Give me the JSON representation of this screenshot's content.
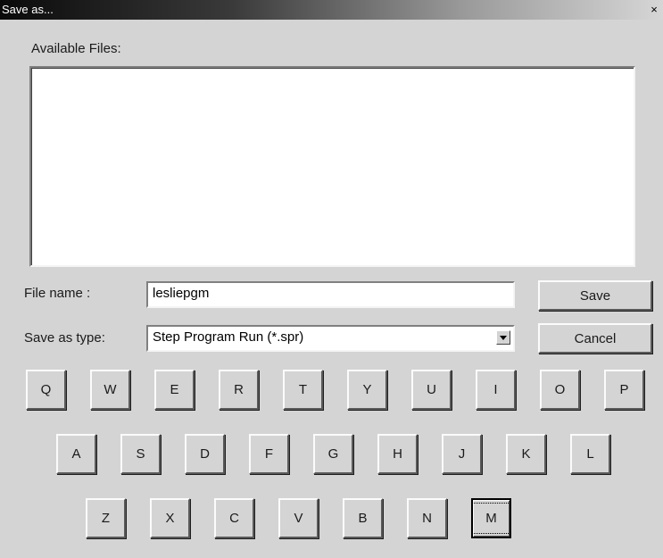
{
  "window": {
    "title": "Save as...",
    "close_glyph": "×"
  },
  "labels": {
    "available_files": "Available Files:",
    "file_name": "File name :",
    "save_as_type": "Save as type:"
  },
  "file_name_value": "lesliepgm",
  "save_type": {
    "selected": "Step Program Run (*.spr)"
  },
  "buttons": {
    "save": "Save",
    "cancel": "Cancel"
  },
  "keyboard": {
    "row1": [
      "Q",
      "W",
      "E",
      "R",
      "T",
      "Y",
      "U",
      "I",
      "O",
      "P"
    ],
    "row2": [
      "A",
      "S",
      "D",
      "F",
      "G",
      "H",
      "J",
      "K",
      "L"
    ],
    "row3": [
      "Z",
      "X",
      "C",
      "V",
      "B",
      "N",
      "M"
    ],
    "focused_key": "M"
  }
}
